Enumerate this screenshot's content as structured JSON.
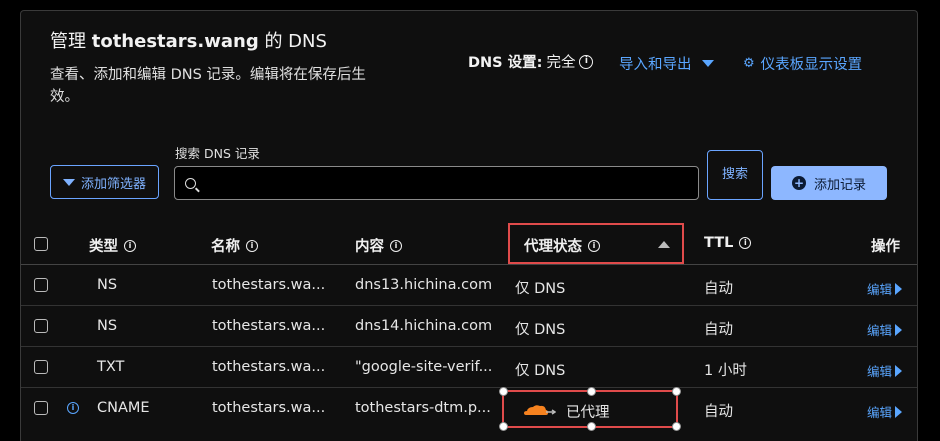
{
  "header": {
    "title_prefix": "管理",
    "domain": "tothestars.wang",
    "title_suffix": "的 DNS",
    "description": "查看、添加和编辑 DNS 记录。编辑将在保存后生效。",
    "dns_setting_label": "DNS 设置:",
    "dns_setting_value": "完全",
    "import_export_label": "导入和导出",
    "dashboard_settings_label": "仪表板显示设置"
  },
  "toolbar": {
    "filter_label": "添加筛选器",
    "search_label": "搜索 DNS 记录",
    "search_value": "",
    "search_button_label": "搜索",
    "add_record_label": "添加记录"
  },
  "table": {
    "columns": {
      "type": "类型",
      "name": "名称",
      "content": "内容",
      "proxy_status": "代理状态",
      "ttl": "TTL",
      "actions": "操作"
    },
    "rows": [
      {
        "type": "NS",
        "name": "tothestars.wa...",
        "content": "dns13.hichina.com",
        "proxy": "仅 DNS",
        "ttl": "自动",
        "edit": "编辑"
      },
      {
        "type": "NS",
        "name": "tothestars.wa...",
        "content": "dns14.hichina.com",
        "proxy": "仅 DNS",
        "ttl": "自动",
        "edit": "编辑"
      },
      {
        "type": "TXT",
        "name": "tothestars.wa...",
        "content": "\"google-site-verif...",
        "proxy": "仅 DNS",
        "ttl": "1 小时",
        "edit": "编辑"
      },
      {
        "type": "CNAME",
        "name": "tothestars.wa...",
        "content": "tothestars-dtm.p...",
        "proxy": "已代理",
        "ttl": "自动",
        "edit": "编辑"
      }
    ]
  },
  "icons": {
    "info": "info-icon",
    "gear": "gear-icon",
    "funnel": "filter-icon",
    "search": "search-icon",
    "plus": "plus-circle-icon",
    "cloud": "cloud-icon"
  },
  "colors": {
    "accent": "#5aa6ff",
    "primary_button": "#8db7ff",
    "highlight": "#e04b4b",
    "cloud": "#f6821f"
  }
}
